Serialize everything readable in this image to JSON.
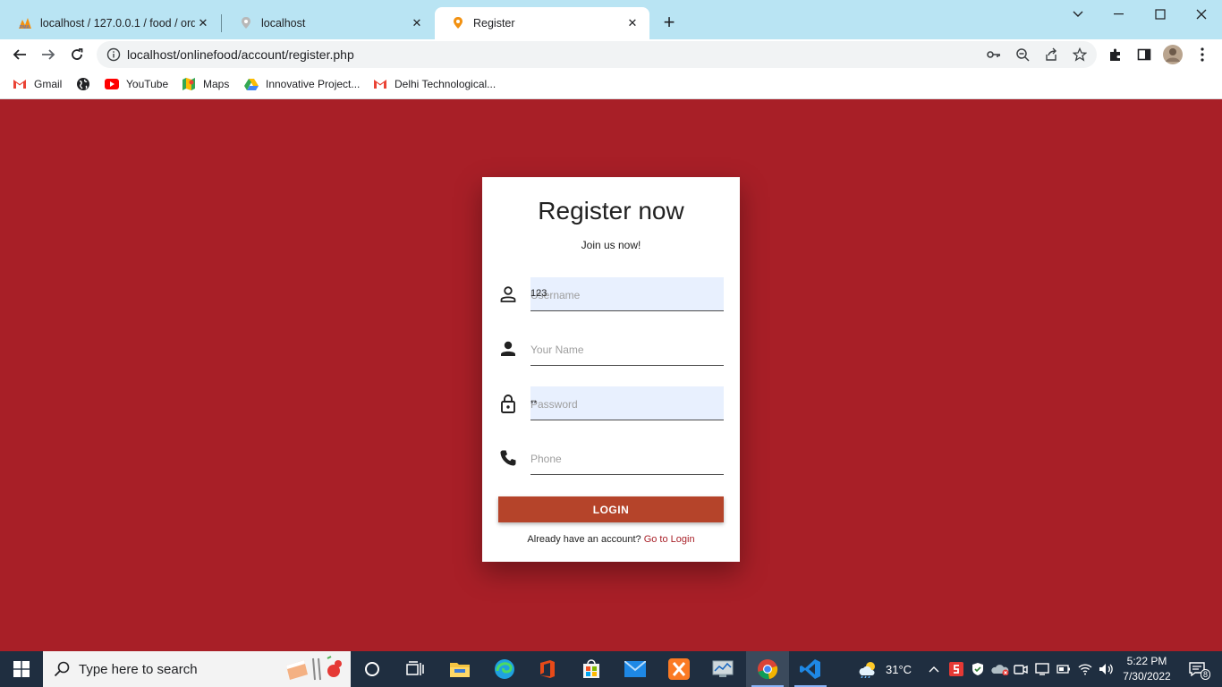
{
  "browser": {
    "tabs": [
      {
        "label": "localhost / 127.0.0.1 / food / ord",
        "favicon": "phpmyadmin-icon"
      },
      {
        "label": "localhost",
        "favicon": "site-icon"
      },
      {
        "label": "Register",
        "favicon": "site-icon",
        "active": true
      }
    ],
    "url": "localhost/onlinefood/account/register.php",
    "bookmarks": [
      {
        "label": "Gmail",
        "icon": "gmail-icon"
      },
      {
        "label": "",
        "icon": "globe-icon"
      },
      {
        "label": "YouTube",
        "icon": "youtube-icon"
      },
      {
        "label": "Maps",
        "icon": "maps-icon"
      },
      {
        "label": "Innovative Project...",
        "icon": "drive-icon"
      },
      {
        "label": "Delhi Technological...",
        "icon": "gmail-icon"
      }
    ]
  },
  "page": {
    "title": "Register now",
    "subtitle": "Join us now!",
    "fields": {
      "username": {
        "placeholder": "Username",
        "value": "123"
      },
      "name": {
        "placeholder": "Your Name",
        "value": ""
      },
      "password": {
        "placeholder": "Password",
        "value": "**"
      },
      "phone": {
        "placeholder": "Phone",
        "value": ""
      }
    },
    "submit_label": "LOGIN",
    "already_text": "Already have an account?",
    "login_link": "Go to Login",
    "colors": {
      "background": "#a81f27",
      "button": "#b5442a"
    }
  },
  "taskbar": {
    "search_placeholder": "Type here to search",
    "temperature": "31°C",
    "time": "5:22 PM",
    "date": "7/30/2022",
    "notification_count": "8"
  }
}
